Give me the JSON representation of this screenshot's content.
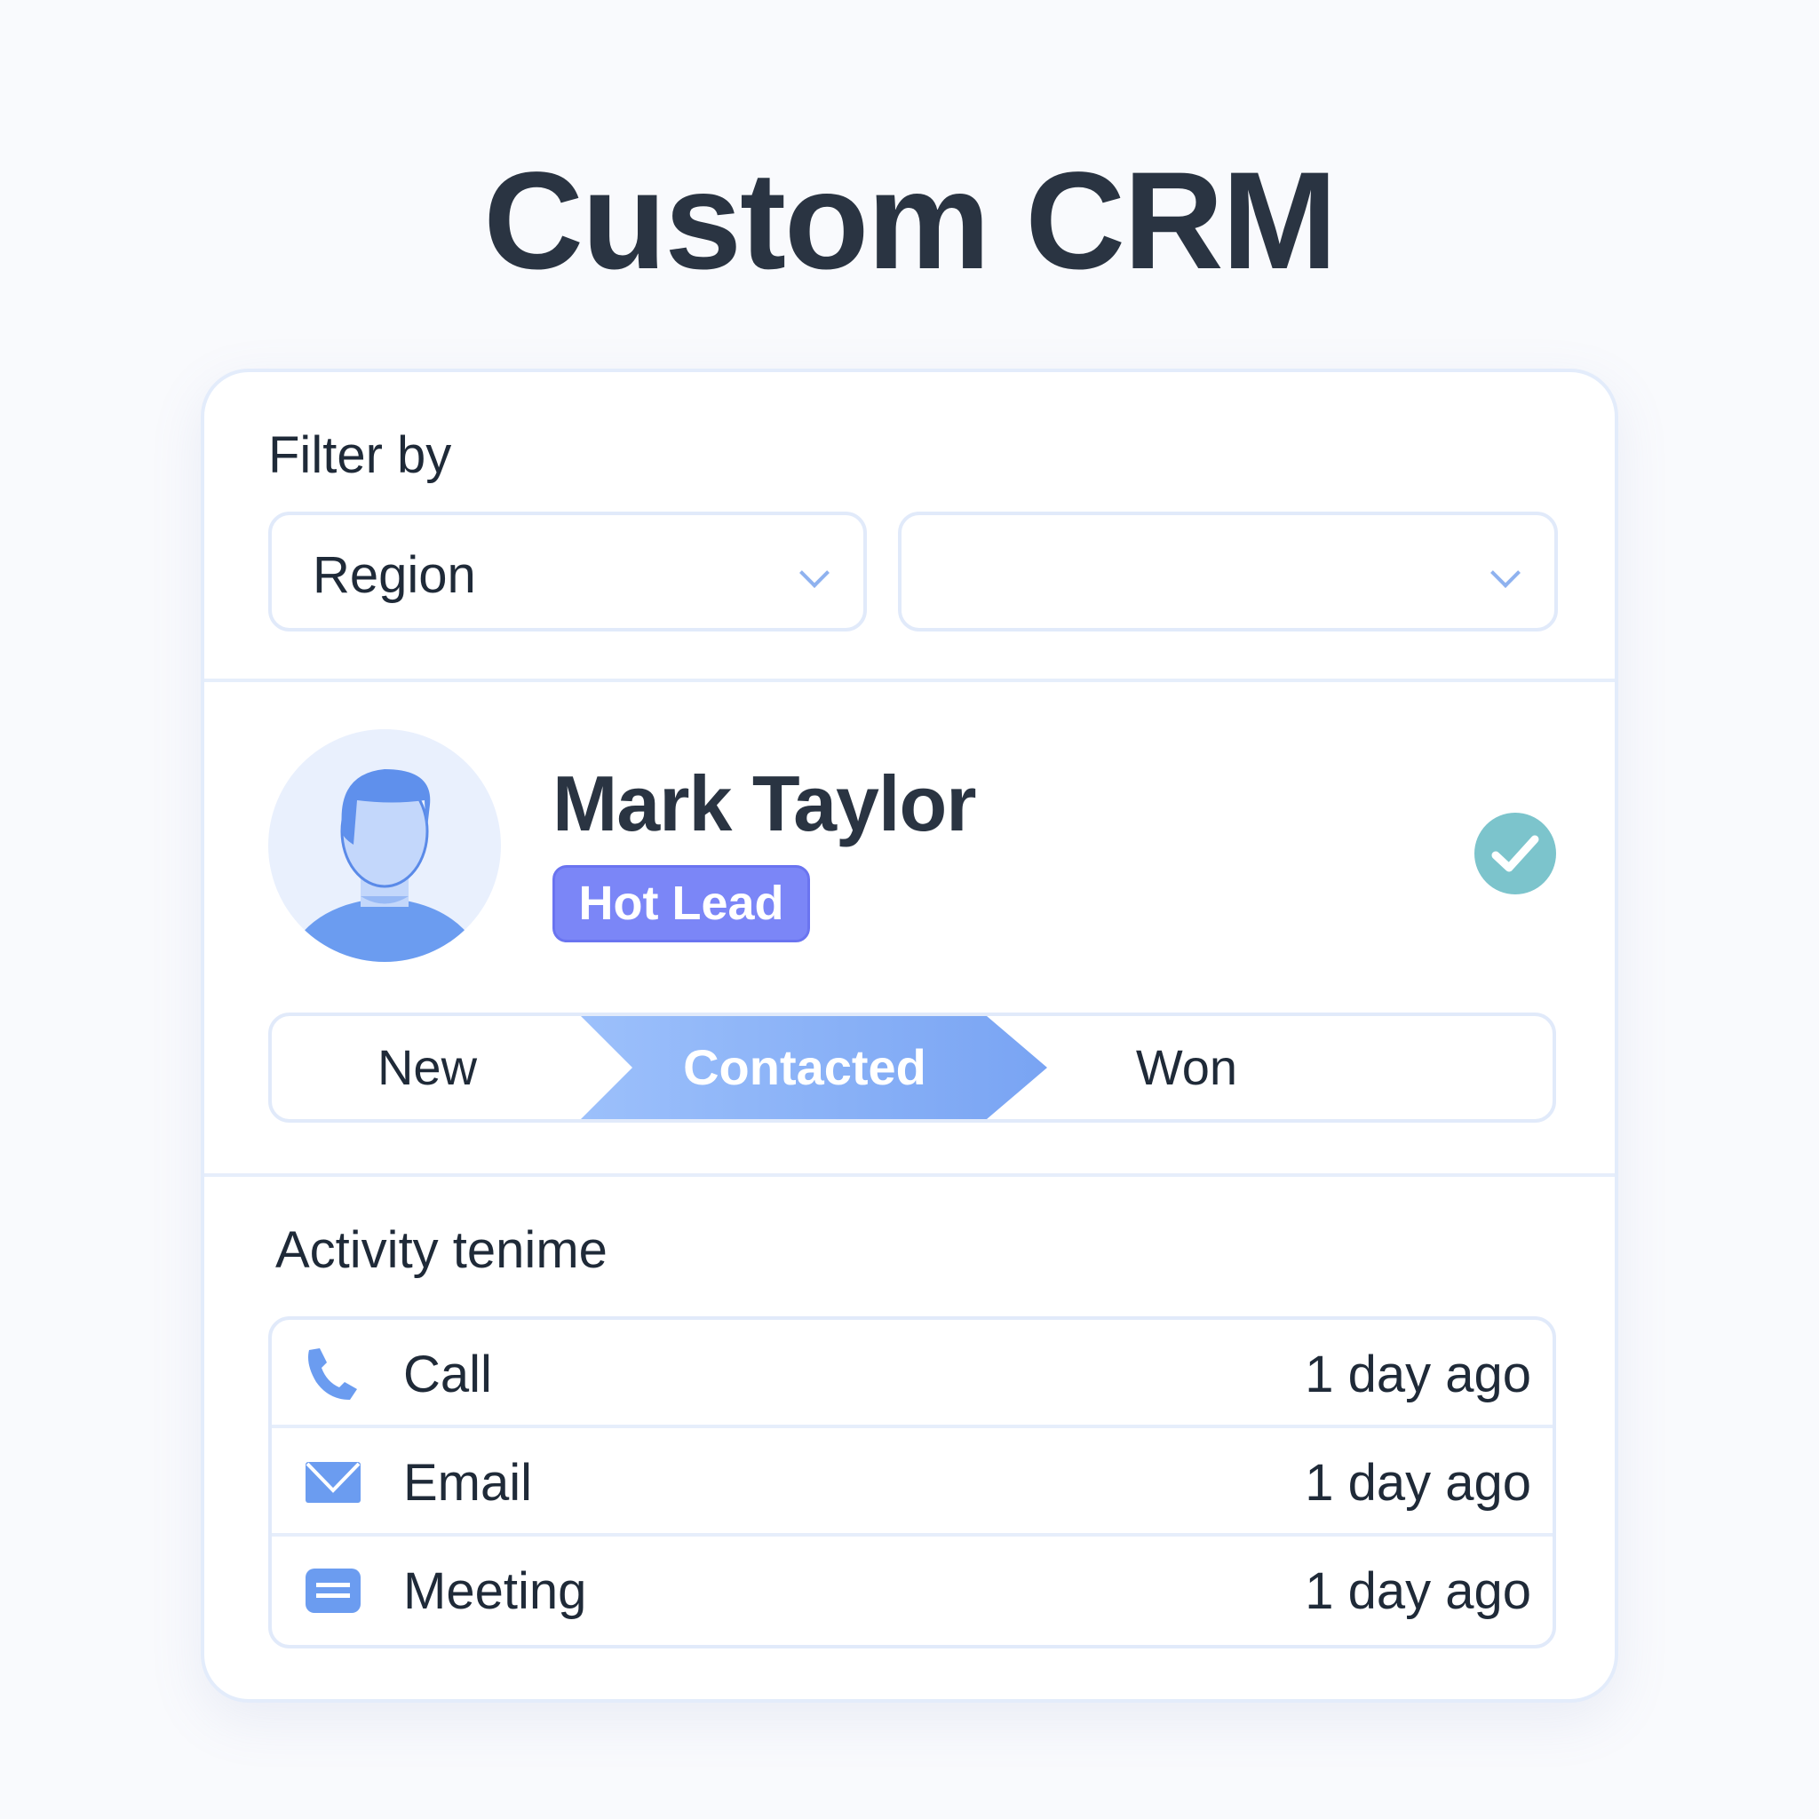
{
  "title": "Custom CRM",
  "filter": {
    "label": "Filter by",
    "region": "Region",
    "second": ""
  },
  "contact": {
    "name": "Mark Taylor",
    "badge": "Hot Lead",
    "verified": true
  },
  "pipeline": {
    "stages": [
      "New",
      "Contacted",
      "Won"
    ],
    "active": "Contacted"
  },
  "activity": {
    "title": "Activity tenime",
    "items": [
      {
        "type": "Call",
        "icon": "phone-icon",
        "time": "1 day ago"
      },
      {
        "type": "Email",
        "icon": "mail-icon",
        "time": "1 day ago"
      },
      {
        "type": "Meeting",
        "icon": "meeting-icon",
        "time": "1 day ago"
      }
    ]
  },
  "colors": {
    "accent": "#7b86f7",
    "stage": "#8fb5f7",
    "check": "#7cc4cc",
    "icon": "#6b9cf0"
  }
}
